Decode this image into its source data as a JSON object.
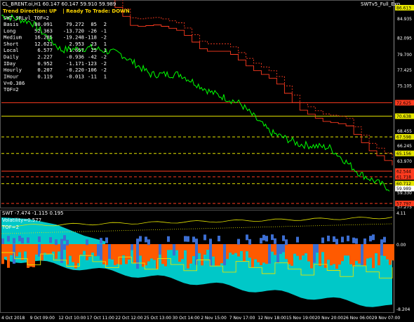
{
  "chart_header": {
    "symbol_line": "CL_BRENT.oi,H1  60.147 60.147 59.910 59.989",
    "indicator_name": "SWTv5_Full_Exp",
    "trend_direction_label": "Trend Direction:",
    "trend_direction_value": "UP",
    "ready_label": "Ready To Trade:",
    "ready_value": "DOWN"
  },
  "info_panel": {
    "title": "SWT_SRLvl_TOF=2",
    "rows": [
      {
        "name": "Basis",
        "c1": "80.091",
        "c2": "79.272",
        "c3": "85",
        "c4": "2"
      },
      {
        "name": "Long",
        "c1": "52.363",
        "c2": "-13.720",
        "c3": "-26",
        "c4": "-1"
      },
      {
        "name": "Medium",
        "c1": "16.285",
        "c2": "-19.248",
        "c3": "-118",
        "c4": "-2"
      },
      {
        "name": "Short",
        "c1": "12.621",
        "c2": "2.953",
        "c3": "23",
        "c4": "1"
      },
      {
        "name": "Local",
        "c1": "6.577",
        "c2": "1.657",
        "c3": "25",
        "c4": "1"
      },
      {
        "name": "Daily",
        "c1": "2.227",
        "c2": "-0.936",
        "c3": "-42",
        "c4": "-2"
      },
      {
        "name": "IDay",
        "c1": "0.952",
        "c2": "-1.171",
        "c3": "-123",
        "c4": "-2"
      },
      {
        "name": "Hourly",
        "c1": "0.207",
        "c2": "-0.220",
        "c3": "-106",
        "c4": "-2"
      },
      {
        "name": "IHour",
        "c1": "0.119",
        "c2": "-0.013",
        "c3": "-11",
        "c4": "1"
      }
    ],
    "v_line": "V=0.386",
    "tof_line": "TOF=2"
  },
  "price_axis": {
    "ticks": [
      "84.935",
      "82.095",
      "79.700",
      "77.425",
      "75.105",
      "72.785",
      "70.465",
      "68.455",
      "66.245",
      "63.970",
      "61.650",
      "59.330",
      "57.275"
    ],
    "labels": [
      {
        "text": "86.613",
        "color": "#e5e500",
        "text_color": "#000"
      },
      {
        "text": "72.625",
        "color": "#ff3b1f",
        "text_color": "#000"
      },
      {
        "text": "70.638",
        "color": "#e5e500",
        "text_color": "#000"
      },
      {
        "text": "67.598",
        "color": "#e5e500",
        "text_color": "#000"
      },
      {
        "text": "65.156",
        "color": "#e5e500",
        "text_color": "#000"
      },
      {
        "text": "62.544",
        "color": "#ff3b1f",
        "text_color": "#000"
      },
      {
        "text": "61.718",
        "color": "#ff3b1f",
        "text_color": "#000"
      },
      {
        "text": "60.712",
        "color": "#e5e500",
        "text_color": "#000"
      },
      {
        "text": "59.989",
        "color": "#ffffff",
        "text_color": "#000"
      },
      {
        "text": "57.797",
        "color": "#ff3b1f",
        "text_color": "#000"
      }
    ]
  },
  "sub_panel": {
    "header": "SWT -7.474 -1.115 0.195",
    "volatility": "Volatility=0.577",
    "tof": "TOF=2",
    "axis": [
      "4.11",
      "0.00",
      "-8.204"
    ]
  },
  "time_axis": [
    "4 Oct 2018",
    "9 Oct 09:00",
    "12 Oct 10:00",
    "17 Oct 11:00",
    "22 Oct 12:00",
    "25 Oct 13:00",
    "30 Oct 14:00",
    "2 Nov 15:00",
    "7 Nov 17:00",
    "12 Nov 18:00",
    "15 Nov 19:00",
    "20 Nov 20:00",
    "26 Nov 06:00",
    "29 Nov 07:00"
  ],
  "colors": {
    "background": "#000000",
    "price": "#00ff00",
    "stop_line": "#ff3b1f",
    "resistance": "#e5e500",
    "cyan_fill": "#00c8c8",
    "orange_fill": "#ff5a00",
    "blue_bars": "#3c6ed2"
  },
  "chart_data": {
    "type": "line",
    "symbol": "CL_BRENT.oi",
    "timeframe": "H1",
    "x": [
      "4 Oct 2018",
      "9 Oct 09:00",
      "12 Oct 10:00",
      "17 Oct 11:00",
      "22 Oct 12:00",
      "25 Oct 13:00",
      "30 Oct 14:00",
      "2 Nov 15:00",
      "7 Nov 17:00",
      "12 Nov 18:00",
      "15 Nov 19:00",
      "20 Nov 20:00",
      "26 Nov 06:00",
      "29 Nov 07:00"
    ],
    "series": [
      {
        "name": "Close",
        "values": [
          85.5,
          84.5,
          80.4,
          80.7,
          79.8,
          76.8,
          76.8,
          74.2,
          72.5,
          68.3,
          66.5,
          66.0,
          62.2,
          60.0
        ]
      }
    ],
    "ylim": [
      57.275,
      86.613
    ],
    "horizontal_levels": [
      72.625,
      70.638,
      67.598,
      65.156,
      62.544,
      61.718,
      60.712,
      57.797
    ],
    "last_price": 59.989
  }
}
